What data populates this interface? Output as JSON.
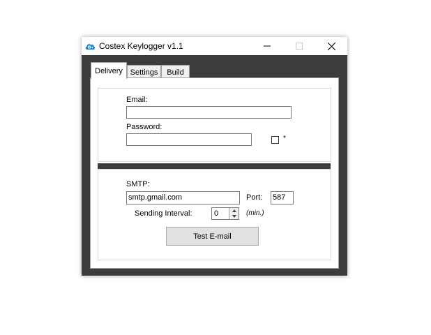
{
  "window": {
    "title": "Costex Keylogger v1.1",
    "icon": "cloud-key-icon"
  },
  "titlebar_buttons": [
    "minimize",
    "maximize",
    "close"
  ],
  "tabs": [
    {
      "label": "Delivery",
      "active": true
    },
    {
      "label": "Settings",
      "active": false
    },
    {
      "label": "Build",
      "active": false
    }
  ],
  "email_section": {
    "email_label": "Email:",
    "email_value": "",
    "password_label": "Password:",
    "password_value": "",
    "show_password_checkbox_label": "*",
    "show_password_checked": false
  },
  "smtp_section": {
    "smtp_label": "SMTP:",
    "smtp_value": "smtp.gmail.com",
    "port_label": "Port:",
    "port_value": "587",
    "interval_label": "Sending Interval:",
    "interval_value": "0",
    "interval_unit": "(min.)",
    "test_button_label": "Test E-mail"
  },
  "colors": {
    "window_background": "#3c3c3c",
    "accent_icon": "#1e88c8"
  }
}
